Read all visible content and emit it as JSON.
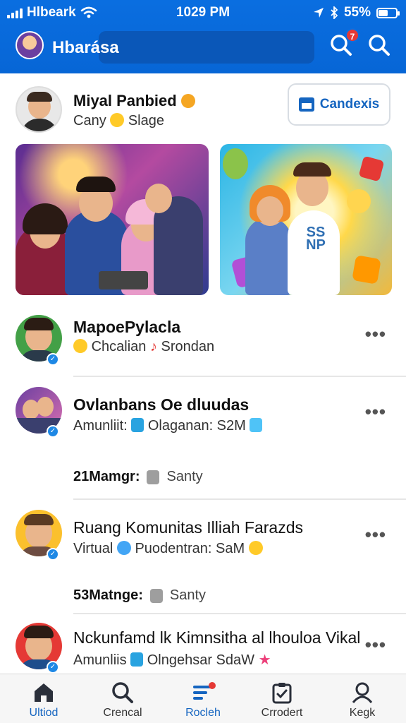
{
  "status_bar": {
    "carrier": "Hlbeark",
    "time": "1029 PM",
    "battery": "55%",
    "battery_level": 0.55
  },
  "header": {
    "title": "Hbarásа",
    "notification_count": "7",
    "icons": [
      "avatar",
      "search-icon",
      "search-icon"
    ]
  },
  "profile": {
    "name": "Miyal Panbied",
    "subtitle_left": "Cany",
    "subtitle_right": "Slage",
    "action_label": "Candexis"
  },
  "media_cards": [
    {
      "label": "group-photo"
    },
    {
      "label": "celebration-illustration",
      "shirt_text": "SS NP"
    }
  ],
  "feed": [
    {
      "name": "MapoePylacla",
      "sub_left": "Chcalian",
      "sub_right": "Srondan"
    },
    {
      "name": "Ovlanbans Oe dluudas",
      "sub_left": "Amunliit:",
      "sub_right": "Olaganan: S2M",
      "meta_count": "21Mamgr:",
      "meta_label": "Santy"
    },
    {
      "name": "Ruang Komunitas Illiah Farazds",
      "sub_left": "Virtual",
      "sub_right": "Puodentran: SaM",
      "meta_count": "53Matnge:",
      "meta_label": "Santy"
    },
    {
      "name": "Nckunfamd lk Kimnsitha al lhouloa Vikal",
      "sub_left": "Amunliis",
      "sub_right": "Olngehsar SdaW"
    }
  ],
  "bottom_nav": [
    {
      "label": "Ultiod",
      "icon": "home-icon",
      "active": true
    },
    {
      "label": "Crencal",
      "icon": "search-icon",
      "active": false
    },
    {
      "label": "Rocleh",
      "icon": "feed-icon",
      "active": true
    },
    {
      "label": "Crrodert",
      "icon": "clipboard-icon",
      "active": false
    },
    {
      "label": "Kegk",
      "icon": "profile-icon",
      "active": false
    }
  ],
  "colors": {
    "header_blue": "#0a6ee0",
    "accent_blue": "#1565c0",
    "badge_red": "#e53935"
  }
}
